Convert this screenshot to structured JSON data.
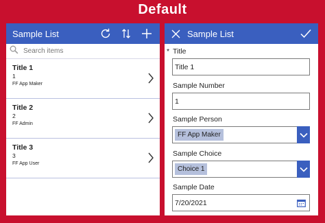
{
  "banner": {
    "title": "Default"
  },
  "colors": {
    "accent": "#3a5fbf",
    "frame": "#c8102e",
    "chip": "#b5c0dc"
  },
  "list": {
    "title": "Sample List",
    "icons": [
      "refresh-icon",
      "sort-icon",
      "add-icon"
    ],
    "search_placeholder": "Search items",
    "items": [
      {
        "title": "Title 1",
        "number": "1",
        "person": "FF App Maker"
      },
      {
        "title": "Title 2",
        "number": "2",
        "person": "FF Admin"
      },
      {
        "title": "Title 3",
        "number": "3",
        "person": "FF App User"
      }
    ]
  },
  "form": {
    "title": "Sample List",
    "icons": [
      "close-icon",
      "checkmark-icon"
    ],
    "required_marker": "*",
    "fields": {
      "title": {
        "label": "Title",
        "value": "Title 1"
      },
      "number": {
        "label": "Sample Number",
        "value": "1"
      },
      "person": {
        "label": "Sample Person",
        "value": "FF App Maker"
      },
      "choice": {
        "label": "Sample Choice",
        "value": "Choice 1"
      },
      "date": {
        "label": "Sample Date",
        "value": "7/20/2021"
      }
    }
  }
}
